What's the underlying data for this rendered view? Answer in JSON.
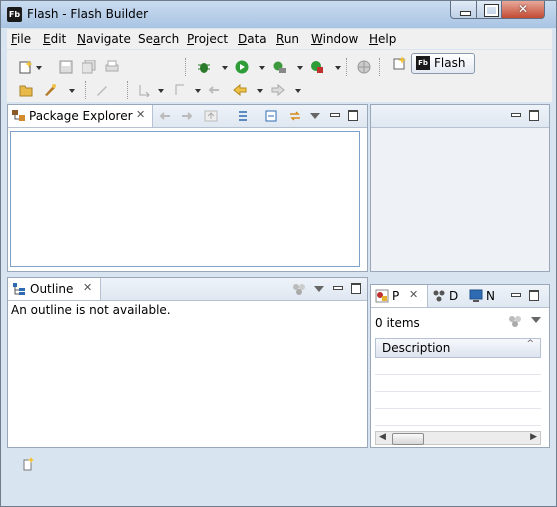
{
  "window": {
    "title": "Flash - Flash Builder",
    "app_icon": "Fb"
  },
  "menu": [
    {
      "pre": "",
      "u": "F",
      "post": "ile"
    },
    {
      "pre": "",
      "u": "E",
      "post": "dit"
    },
    {
      "pre": "",
      "u": "N",
      "post": "avigate"
    },
    {
      "pre": "Se",
      "u": "a",
      "post": "rch"
    },
    {
      "pre": "",
      "u": "P",
      "post": "roject"
    },
    {
      "pre": "",
      "u": "D",
      "post": "ata"
    },
    {
      "pre": "",
      "u": "R",
      "post": "un"
    },
    {
      "pre": "",
      "u": "W",
      "post": "indow"
    },
    {
      "pre": "",
      "u": "H",
      "post": "elp"
    }
  ],
  "perspective": {
    "label": "Flash",
    "icon": "Fb"
  },
  "package_explorer": {
    "tab_label": "Package Explorer",
    "close": "✕"
  },
  "outline": {
    "tab_label": "Outline",
    "close": "✕",
    "message": "An outline is not available."
  },
  "problems": {
    "tabs": [
      {
        "label": "P",
        "icon": "problems-icon"
      },
      {
        "label": "D",
        "icon": "data-services-icon"
      },
      {
        "label": "N",
        "icon": "network-monitor-icon"
      }
    ],
    "close": "✕",
    "items_count": "0 items",
    "column": "Description"
  },
  "colors": {
    "accent": "#3a6ea5",
    "run_green": "#2e9d37",
    "debug_green": "#2c7a2c"
  }
}
